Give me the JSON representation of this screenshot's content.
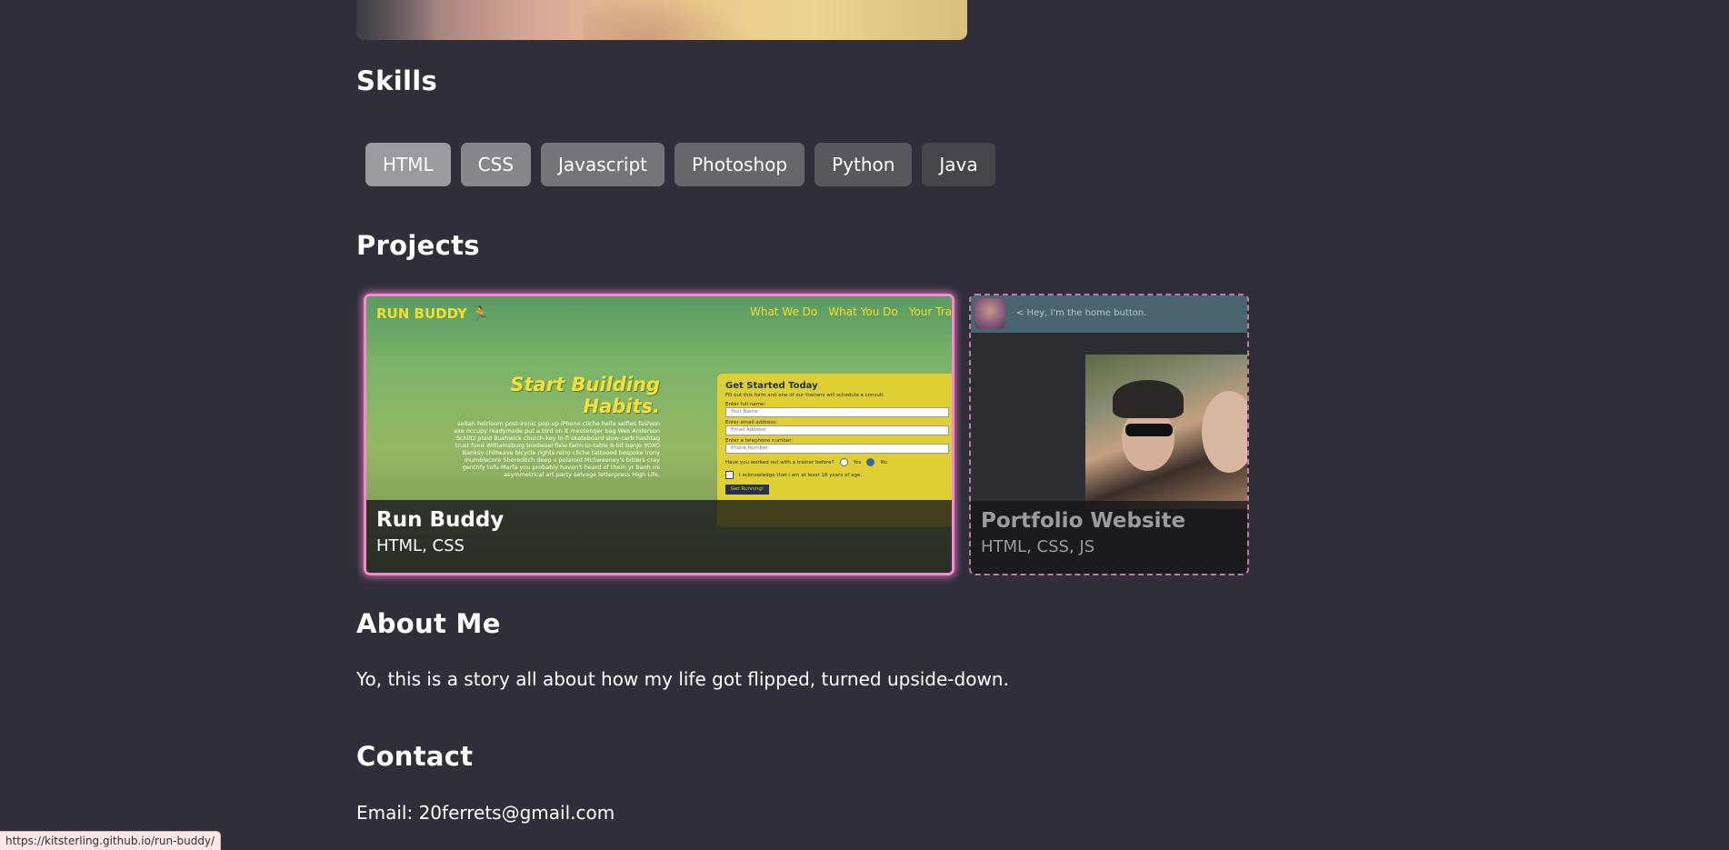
{
  "sections": {
    "skills_heading": "Skills",
    "projects_heading": "Projects",
    "about_heading": "About Me",
    "contact_heading": "Contact"
  },
  "skills": [
    {
      "label": "HTML",
      "color": "#9a9aa0"
    },
    {
      "label": "CSS",
      "color": "#86868c"
    },
    {
      "label": "Javascript",
      "color": "#74747a"
    },
    {
      "label": "Photoshop",
      "color": "#66666c"
    },
    {
      "label": "Python",
      "color": "#57575e"
    },
    {
      "label": "Java",
      "color": "#44444b"
    }
  ],
  "projects": [
    {
      "title": "Run Buddy",
      "tech": "HTML, CSS",
      "screenshot": {
        "logo": "RUN BUDDY 🏃",
        "nav": [
          "What We Do",
          "What You Do",
          "Your Tra"
        ],
        "hero_title": "Start Building Habits.",
        "hero_text": "seitan heirloom post-ironic pop-up iPhone cliche hella selfies fashion axe occupy readymade put a bird on it messenger bag Wes Anderson Schlitz plaid Bushwick church-key lo-fi skateboard slow-carb hashtag trust fund Williamsburg biodiesel fixie farm-to-table 8-bit banjo XOXO Banksy chillwave bicycle rights retro cliche tattooed bespoke irony mumblecore Shoreditch deep v polaroid McSweeney's bitters cray gentrify tofu Marfa you probably haven't heard of them yr banh mi asymmetrical art party selvage letterpress High Life.",
        "form_title": "Get Started Today",
        "form_sub": "Fill out this form and one of our trainers will schedule a consult.",
        "name_label": "Enter full name:",
        "name_placeholder": "Your Name",
        "email_label": "Enter email address:",
        "email_placeholder": "Email Address",
        "phone_label": "Enter a telephone number:",
        "phone_placeholder": "Phone Number",
        "trainer_question": "Have you worked out with a trainer before?",
        "yes_label": "Yes",
        "no_label": "No",
        "ack_label": "I acknowledge that I am at least 18 years of age.",
        "submit_label": "Get Running!"
      }
    },
    {
      "title": "Portfolio Website",
      "tech": "HTML, CSS, JS",
      "screenshot": {
        "home_text": "< Hey, I'm the home button."
      }
    }
  ],
  "about": {
    "text": "Yo, this is a story all about how my life got flipped, turned upside-down."
  },
  "contact": {
    "email": "Email: 20ferrets@gmail.com"
  },
  "status_bar": {
    "url": "https://kitsterling.github.io/run-buddy/"
  }
}
